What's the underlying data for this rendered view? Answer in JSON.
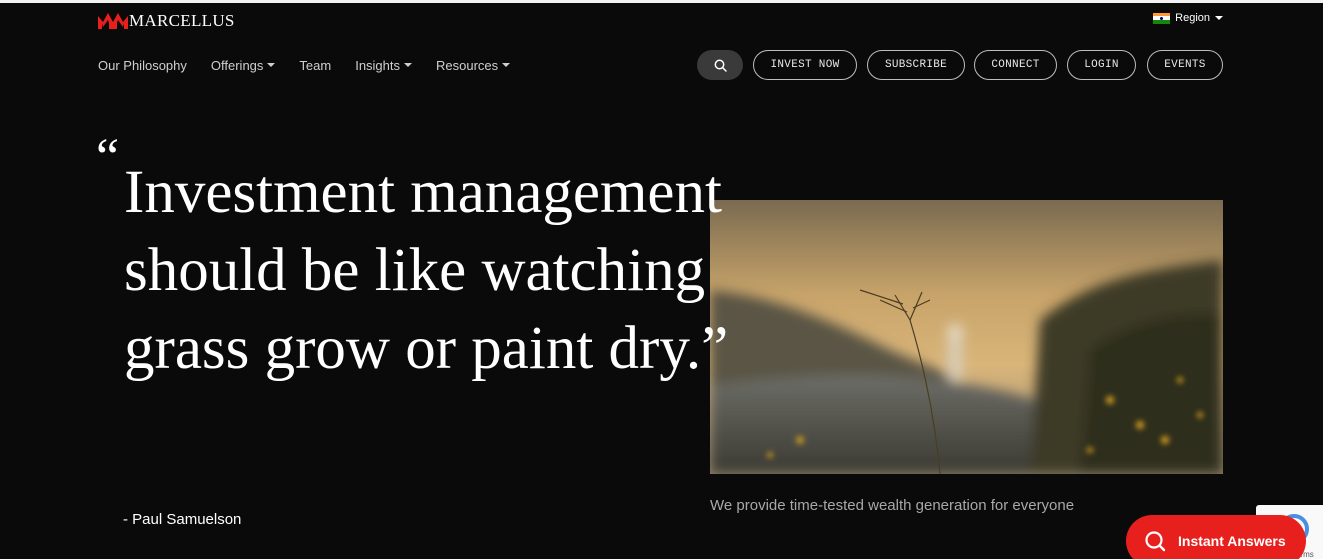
{
  "brand": {
    "name": "MARCELLUS",
    "accent": "#e8201d"
  },
  "region": {
    "label": "Region",
    "flag_icon": "india-flag-icon"
  },
  "nav": [
    {
      "label": "Our Philosophy",
      "dropdown": false
    },
    {
      "label": "Offerings",
      "dropdown": true
    },
    {
      "label": "Team",
      "dropdown": false
    },
    {
      "label": "Insights",
      "dropdown": true
    },
    {
      "label": "Resources",
      "dropdown": true
    }
  ],
  "actions": {
    "search_icon": "search-icon",
    "invest_now": "INVEST NOW",
    "subscribe": "SUBSCRIBE",
    "connect": "CONNECT",
    "login": "LOGIN",
    "events": "EVENTS"
  },
  "hero": {
    "open_quote": "“",
    "quote": "Investment management should be like watching grass grow or paint dry.”",
    "author": "- Paul Samuelson",
    "caption": "We provide time-tested wealth generation for everyone"
  },
  "widgets": {
    "instant_answers": "Instant Answers",
    "recaptcha_text": "erms"
  }
}
